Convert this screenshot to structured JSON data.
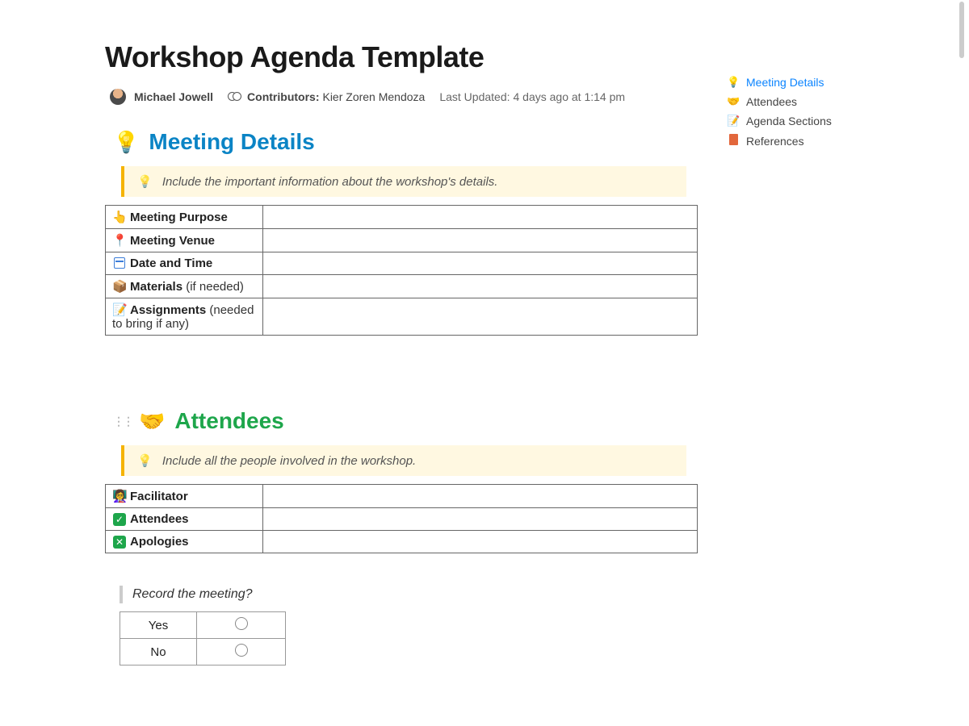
{
  "title": "Workshop Agenda Template",
  "author": "Michael Jowell",
  "contributors_label": "Contributors:",
  "contributors": "Kier Zoren Mendoza",
  "last_updated_label": "Last Updated:",
  "last_updated": "4 days ago at 1:14 pm",
  "sections": {
    "meeting_details": {
      "heading": "Meeting Details",
      "callout": "Include the important information about the workshop's details.",
      "rows": [
        {
          "icon": "👆",
          "label": "Meeting Purpose",
          "sub": "",
          "value": ""
        },
        {
          "icon": "📍",
          "label": "Meeting Venue",
          "sub": "",
          "value": ""
        },
        {
          "icon": "cal",
          "label": "Date and Time",
          "sub": "",
          "value": ""
        },
        {
          "icon": "📦",
          "label": "Materials",
          "sub": "(if needed)",
          "value": ""
        },
        {
          "icon": "📝",
          "label": "Assignments",
          "sub": "(needed to bring if any)",
          "value": ""
        }
      ]
    },
    "attendees": {
      "heading": "Attendees",
      "callout": "Include all the people involved in the workshop.",
      "rows": [
        {
          "icon": "👩‍🏫",
          "label": "Facilitator",
          "value": ""
        },
        {
          "icon": "check",
          "label": "Attendees",
          "value": ""
        },
        {
          "icon": "x",
          "label": "Apologies",
          "value": ""
        }
      ]
    }
  },
  "record_prompt": "Record the meeting?",
  "record_options": [
    {
      "label": "Yes",
      "selected": false
    },
    {
      "label": "No",
      "selected": false
    }
  ],
  "outline": [
    {
      "icon": "💡",
      "label": "Meeting Details",
      "active": true
    },
    {
      "icon": "🤝",
      "label": "Attendees",
      "active": false
    },
    {
      "icon": "📝",
      "label": "Agenda Sections",
      "active": false
    },
    {
      "icon": "orange",
      "label": "References",
      "active": false
    }
  ]
}
